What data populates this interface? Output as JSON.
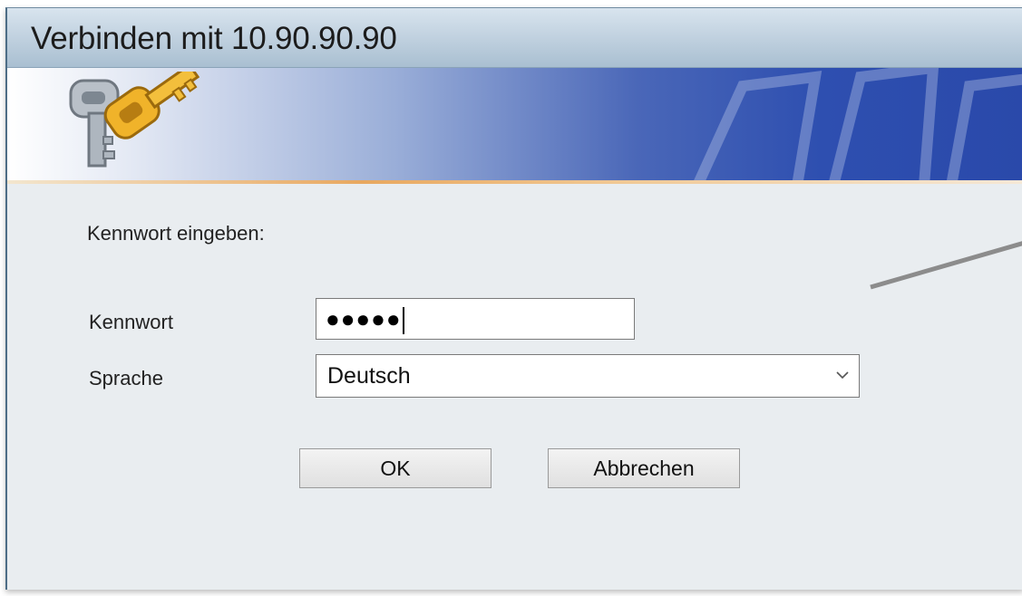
{
  "window": {
    "title": "Verbinden mit 10.90.90.90"
  },
  "form": {
    "prompt": "Kennwort eingeben:",
    "password_label": "Kennwort",
    "password_value": "●●●●●",
    "language_label": "Sprache",
    "language_value": "Deutsch"
  },
  "buttons": {
    "ok": "OK",
    "cancel": "Abbrechen"
  },
  "icons": {
    "banner_icon": "keys-icon",
    "select_icon": "chevron-down-icon"
  },
  "colors": {
    "banner_blue": "#2e4fb0",
    "titlebar": "#c3d3e1",
    "accent_line": "#e8a860"
  }
}
